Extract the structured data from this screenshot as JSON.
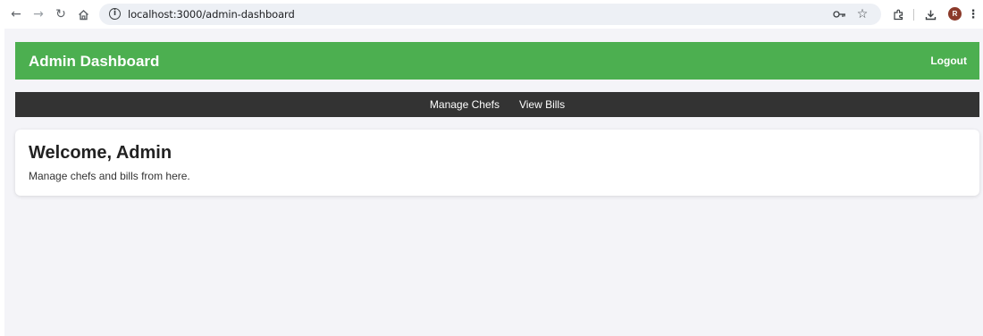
{
  "browser": {
    "url": "localhost:3000/admin-dashboard",
    "avatar_initial": "R",
    "icons": {
      "back": "back-arrow-icon",
      "forward": "forward-arrow-icon",
      "reload": "reload-icon",
      "home": "home-icon",
      "info": "info-icon",
      "password": "key-icon",
      "bookmark": "star-icon",
      "extensions": "puzzle-icon",
      "download": "download-icon",
      "menu": "kebab-menu-icon"
    }
  },
  "header": {
    "title": "Admin Dashboard",
    "logout_label": "Logout",
    "color": "#4caf50"
  },
  "nav": {
    "items": [
      {
        "label": "Manage Chefs"
      },
      {
        "label": "View Bills"
      }
    ],
    "color": "#333333"
  },
  "welcome": {
    "title": "Welcome, Admin",
    "subtitle": "Manage chefs and bills from here."
  }
}
